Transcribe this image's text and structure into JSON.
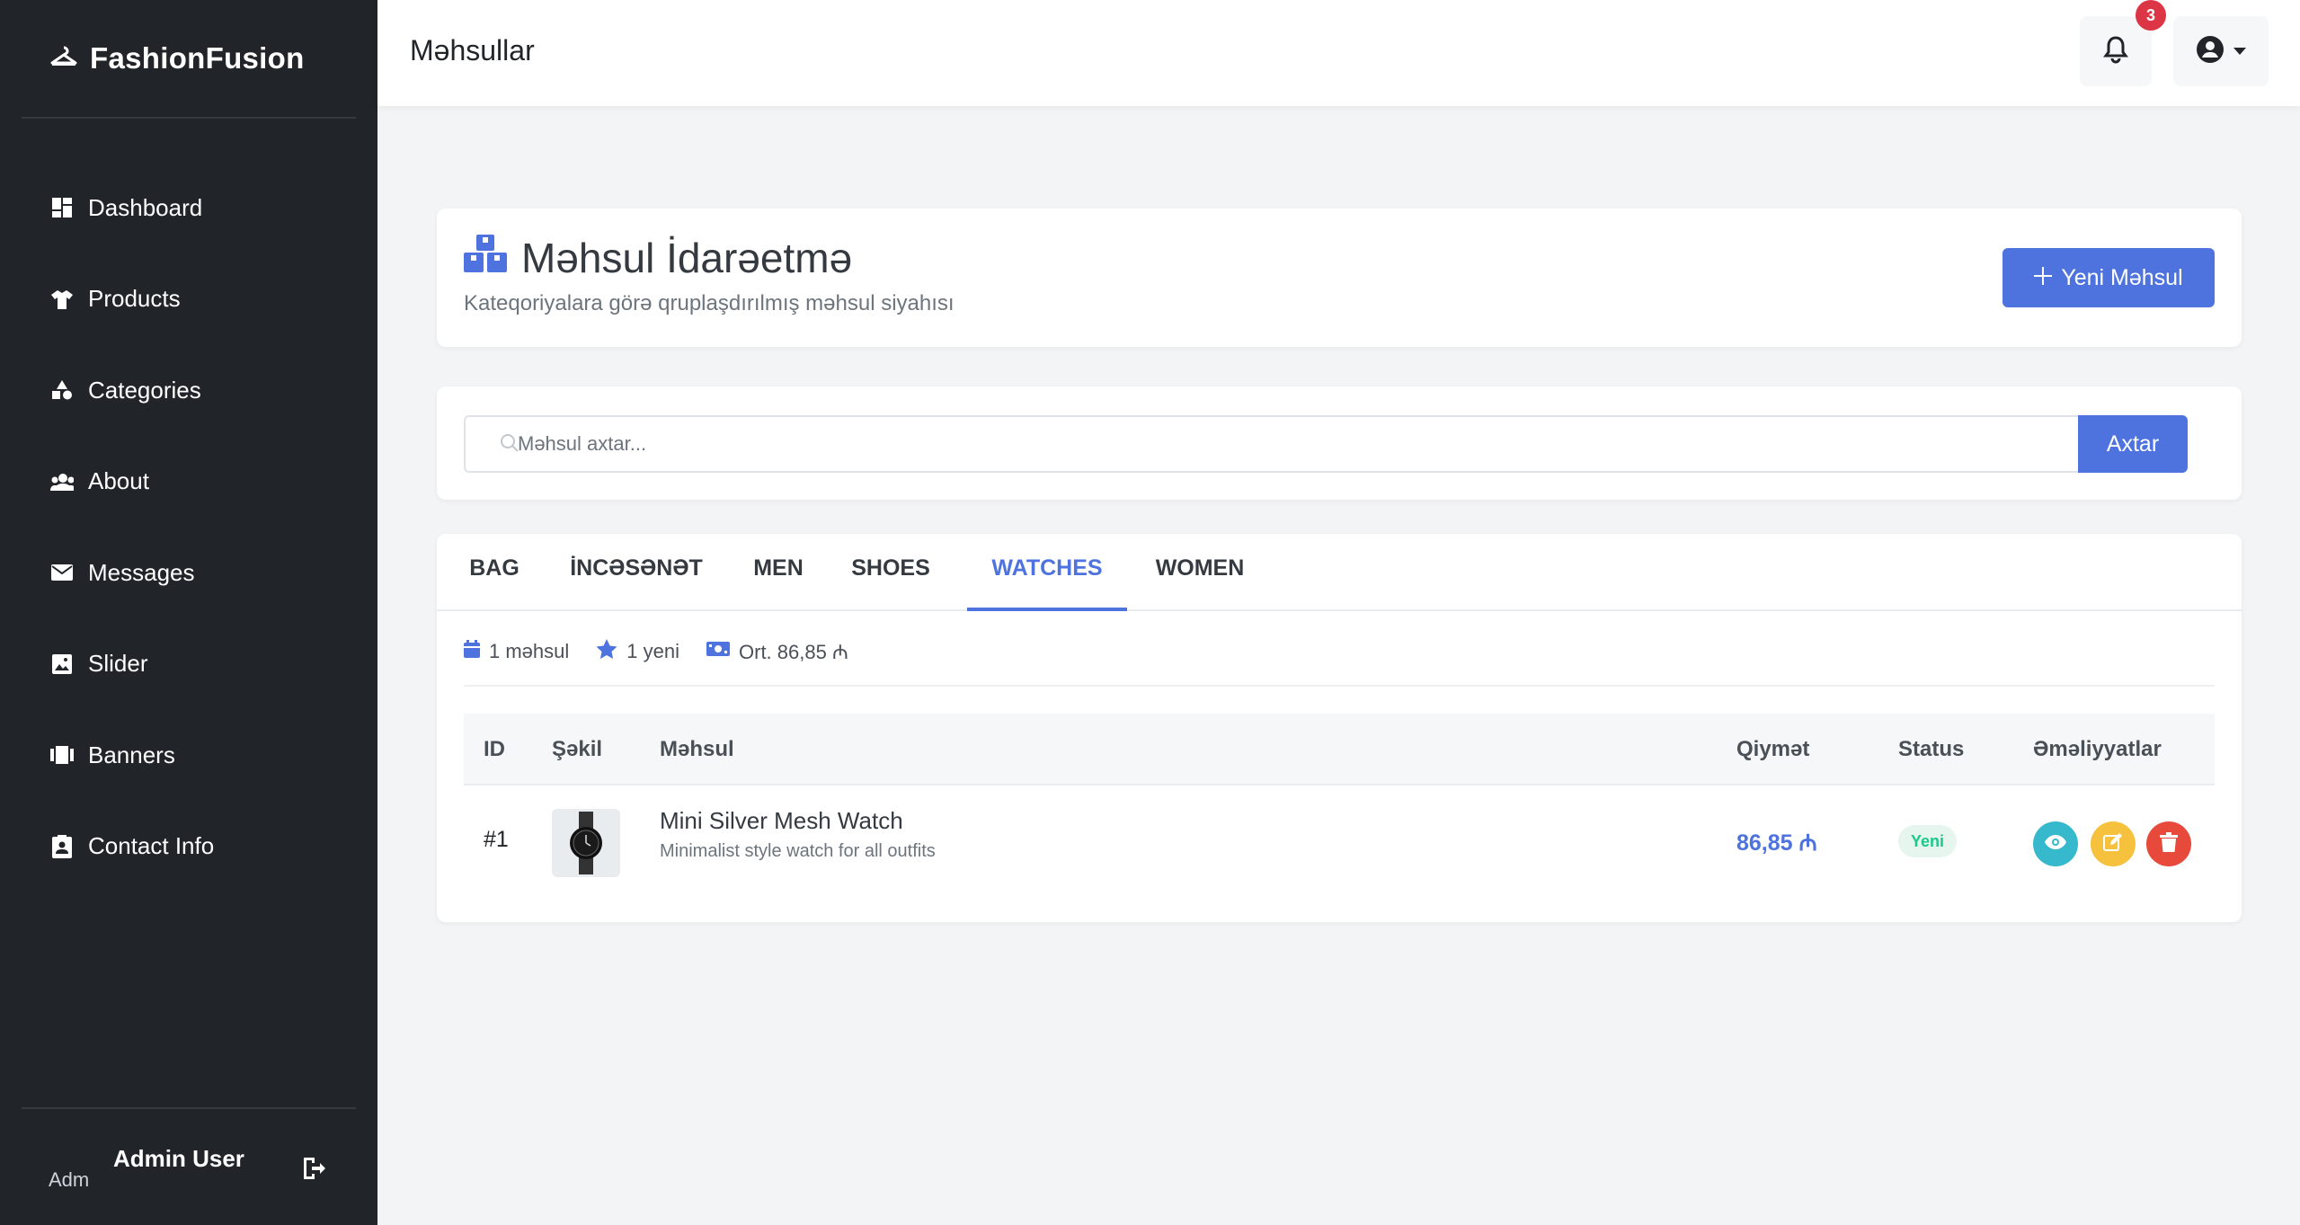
{
  "brand": {
    "name": "FashionFusion",
    "icon": "hanger-icon"
  },
  "sidebar": {
    "items": [
      {
        "label": "Dashboard",
        "icon": "dashboard-icon"
      },
      {
        "label": "Products",
        "icon": "shirt-icon"
      },
      {
        "label": "Categories",
        "icon": "shapes-icon"
      },
      {
        "label": "About",
        "icon": "users-icon"
      },
      {
        "label": "Messages",
        "icon": "envelope-icon"
      },
      {
        "label": "Slider",
        "icon": "image-icon"
      },
      {
        "label": "Banners",
        "icon": "banner-icon"
      },
      {
        "label": "Contact Info",
        "icon": "contact-card-icon"
      }
    ],
    "user": {
      "name": "Admin User",
      "avatar_alt": "Adm"
    }
  },
  "header": {
    "title": "Məhsullar",
    "notifications_count": "3"
  },
  "hero": {
    "title": "Məhsul İdarəetmə",
    "subtitle": "Kateqoriyalara görə qruplaşdırılmış məhsul siyahısı",
    "new_button": "Yeni Məhsul"
  },
  "search": {
    "placeholder": "Məhsul axtar...",
    "button": "Axtar"
  },
  "tabs": [
    {
      "label": "BAG"
    },
    {
      "label": "İNCƏSƏNƏT"
    },
    {
      "label": "MEN"
    },
    {
      "label": "SHOES"
    },
    {
      "label": "WATCHES",
      "active": true
    },
    {
      "label": "WOMEN"
    }
  ],
  "stats": {
    "count": "1 məhsul",
    "new": "1 yeni",
    "avg": "Ort. 86,85 ₼"
  },
  "table": {
    "headers": {
      "id": "ID",
      "image": "Şəkil",
      "product": "Məhsul",
      "price": "Qiymət",
      "status": "Status",
      "actions": "Əməliyyatlar"
    },
    "rows": [
      {
        "id": "#1",
        "name": "Mini Silver Mesh Watch",
        "description": "Minimalist style watch for all outfits",
        "price": "86,85 ₼",
        "status": "Yeni"
      }
    ]
  },
  "colors": {
    "primary": "#4e73df",
    "sidebar": "#212529",
    "danger": "#e74a3b",
    "warning": "#f6c23e",
    "info": "#36b9cc",
    "success": "#1cc88a"
  }
}
